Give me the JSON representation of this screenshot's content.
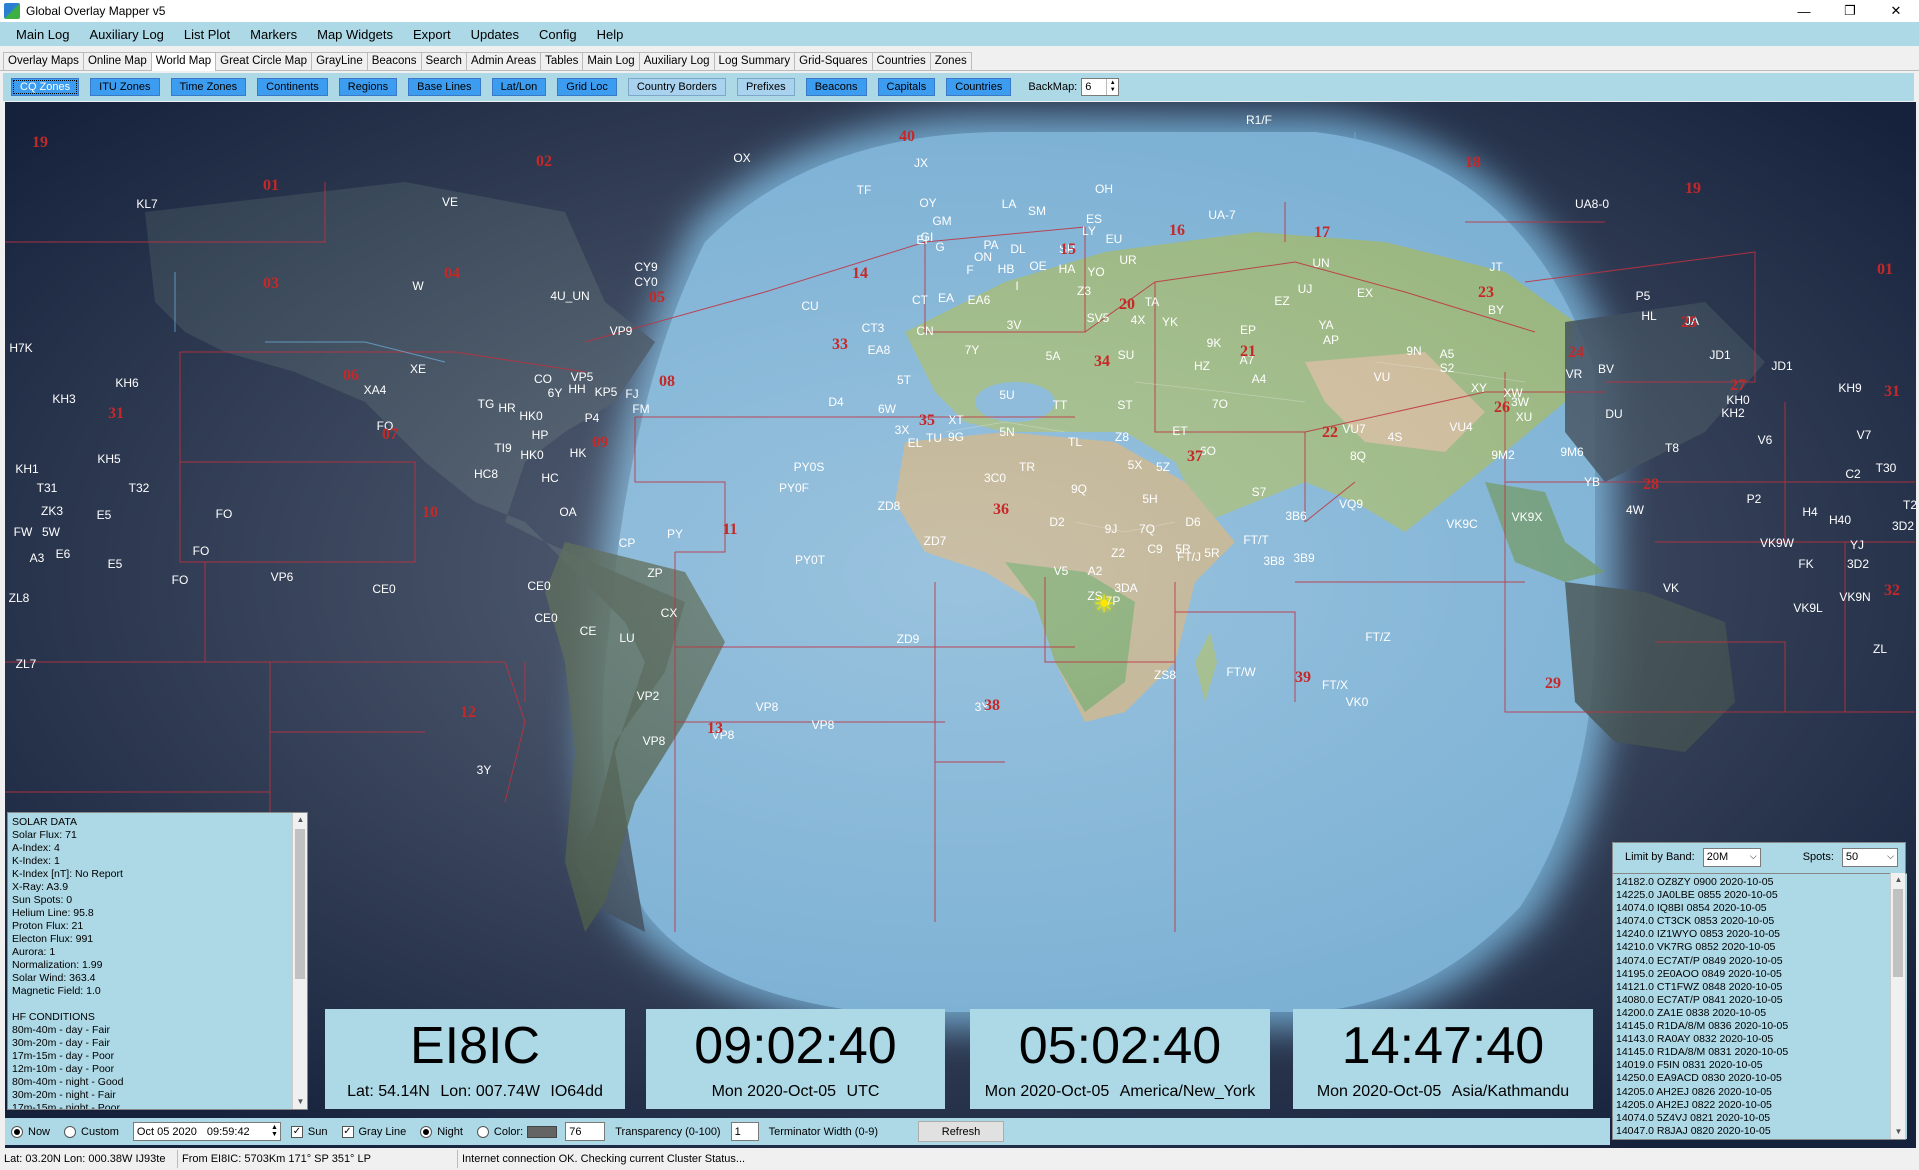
{
  "window": {
    "title": "Global Overlay Mapper v5",
    "minimize": "—",
    "maximize": "❐",
    "close": "✕"
  },
  "menu": [
    "Main Log",
    "Auxiliary Log",
    "List Plot",
    "Markers",
    "Map Widgets",
    "Export",
    "Updates",
    "Config",
    "Help"
  ],
  "tabs": [
    "Overlay Maps",
    "Online Map",
    "World Map",
    "Great Circle Map",
    "GrayLine",
    "Beacons",
    "Search",
    "Admin Areas",
    "Tables",
    "Main Log",
    "Auxiliary Log",
    "Log Summary",
    "Grid-Squares",
    "Countries",
    "Zones"
  ],
  "active_tab": "World Map",
  "toggles": [
    {
      "label": "CQ Zones",
      "state": "sel"
    },
    {
      "label": "ITU Zones",
      "state": "on"
    },
    {
      "label": "Time Zones",
      "state": "on"
    },
    {
      "label": "Continents",
      "state": "on"
    },
    {
      "label": "Regions",
      "state": "on"
    },
    {
      "label": "Base Lines",
      "state": "on"
    },
    {
      "label": "Lat/Lon",
      "state": "on"
    },
    {
      "label": "Grid Loc",
      "state": "on"
    },
    {
      "label": "Country Borders",
      "state": "off"
    },
    {
      "label": "Prefixes",
      "state": "off"
    },
    {
      "label": "Beacons",
      "state": "on"
    },
    {
      "label": "Capitals",
      "state": "on"
    },
    {
      "label": "Countries",
      "state": "on"
    }
  ],
  "backmap": {
    "label": "BackMap:",
    "value": "6"
  },
  "map": {
    "prefixes": [
      [
        "KL7",
        142,
        204
      ],
      [
        "VE",
        445,
        202
      ],
      [
        "W",
        413,
        286
      ],
      [
        "CY9",
        641,
        267
      ],
      [
        "CY0",
        641,
        282
      ],
      [
        "4U_UN",
        565,
        296
      ],
      [
        "VP9",
        616,
        331
      ],
      [
        "H7K",
        16,
        348
      ],
      [
        "KH6",
        122,
        383
      ],
      [
        "KH3",
        59,
        399
      ],
      [
        "XE",
        413,
        369
      ],
      [
        "XA4",
        370,
        390
      ],
      [
        "CO",
        538,
        379
      ],
      [
        "6Y",
        550,
        393
      ],
      [
        "VP5",
        577,
        377
      ],
      [
        "HH",
        572,
        389
      ],
      [
        "KP5",
        601,
        392
      ],
      [
        "FJ",
        627,
        394
      ],
      [
        "FM",
        636,
        409
      ],
      [
        "TG",
        481,
        404
      ],
      [
        "HR",
        502,
        408
      ],
      [
        "HK0",
        526,
        416
      ],
      [
        "P4",
        587,
        418
      ],
      [
        "FO",
        380,
        426
      ],
      [
        "HP",
        535,
        435
      ],
      [
        "TI9",
        498,
        448
      ],
      [
        "HK0",
        527,
        455
      ],
      [
        "HK",
        573,
        453
      ],
      [
        "HC8",
        481,
        474
      ],
      [
        "HC",
        545,
        478
      ],
      [
        "OA",
        563,
        512
      ],
      [
        "KH1",
        22,
        469
      ],
      [
        "KH5",
        104,
        459
      ],
      [
        "T31",
        42,
        488
      ],
      [
        "T32",
        134,
        488
      ],
      [
        "ZK3",
        47,
        511
      ],
      [
        "E5",
        99,
        515
      ],
      [
        "FW",
        18,
        532
      ],
      [
        "5W",
        46,
        532
      ],
      [
        "FO",
        219,
        514
      ],
      [
        "FO",
        196,
        551
      ],
      [
        "A3",
        32,
        558
      ],
      [
        "E6",
        58,
        554
      ],
      [
        "E5",
        110,
        564
      ],
      [
        "FO",
        175,
        580
      ],
      [
        "VP6",
        277,
        577
      ],
      [
        "ZL8",
        14,
        598
      ],
      [
        "CE0",
        379,
        589
      ],
      [
        "CE0",
        534,
        586
      ],
      [
        "CE0",
        541,
        618
      ],
      [
        "CE",
        583,
        631
      ],
      [
        "CP",
        622,
        543
      ],
      [
        "PY",
        670,
        534
      ],
      [
        "ZP",
        650,
        573
      ],
      [
        "CX",
        664,
        613
      ],
      [
        "LU",
        622,
        638
      ],
      [
        "VP2",
        643,
        696
      ],
      [
        "VP8",
        762,
        707
      ],
      [
        "VP8",
        818,
        725
      ],
      [
        "VP8",
        649,
        741
      ],
      [
        "3Y",
        479,
        770
      ],
      [
        "VP8",
        718,
        735
      ],
      [
        "JX",
        916,
        163
      ],
      [
        "OY",
        923,
        203
      ],
      [
        "TF",
        859,
        190
      ],
      [
        "GM",
        937,
        221
      ],
      [
        "GI",
        922,
        237
      ],
      [
        "EI",
        917,
        240
      ],
      [
        "G",
        935,
        247
      ],
      [
        "LA",
        1004,
        204
      ],
      [
        "SM",
        1032,
        211
      ],
      [
        "OH",
        1099,
        189
      ],
      [
        "ES",
        1089,
        219
      ],
      [
        "LY",
        1084,
        231
      ],
      [
        "EU",
        1109,
        239
      ],
      [
        "UA-7",
        1217,
        215
      ],
      [
        "DL",
        1013,
        249
      ],
      [
        "SP",
        1062,
        249
      ],
      [
        "UR",
        1123,
        260
      ],
      [
        "PA",
        986,
        245
      ],
      [
        "ON",
        978,
        257
      ],
      [
        "F",
        965,
        270
      ],
      [
        "HB",
        1001,
        269
      ],
      [
        "OE",
        1033,
        266
      ],
      [
        "HA",
        1062,
        269
      ],
      [
        "YO",
        1091,
        272
      ],
      [
        "CT",
        915,
        300
      ],
      [
        "EA",
        941,
        298
      ],
      [
        "EA6",
        974,
        300
      ],
      [
        "I",
        1012,
        286
      ],
      [
        "Z3",
        1079,
        291
      ],
      [
        "SV5",
        1093,
        318
      ],
      [
        "TA",
        1147,
        302
      ],
      [
        "CU",
        805,
        306
      ],
      [
        "CT3",
        868,
        328
      ],
      [
        "EA8",
        874,
        350
      ],
      [
        "CN",
        920,
        331
      ],
      [
        "3V",
        1009,
        325
      ],
      [
        "5A",
        1048,
        356
      ],
      [
        "SU",
        1121,
        355
      ],
      [
        "4X",
        1133,
        320
      ],
      [
        "YK",
        1165,
        322
      ],
      [
        "9K",
        1209,
        343
      ],
      [
        "EP",
        1243,
        330
      ],
      [
        "YA",
        1321,
        325
      ],
      [
        "AP",
        1326,
        340
      ],
      [
        "EZ",
        1277,
        301
      ],
      [
        "UN",
        1316,
        263
      ],
      [
        "UJ",
        1300,
        289
      ],
      [
        "EX",
        1360,
        293
      ],
      [
        "JT",
        1491,
        267
      ],
      [
        "BY",
        1491,
        310
      ],
      [
        "7Y",
        967,
        350
      ],
      [
        "5T",
        899,
        380
      ],
      [
        "5U",
        1002,
        395
      ],
      [
        "ST",
        1120,
        405
      ],
      [
        "TT",
        1055,
        405
      ],
      [
        "HZ",
        1197,
        366
      ],
      [
        "A4",
        1254,
        379
      ],
      [
        "7O",
        1215,
        404
      ],
      [
        "A7",
        1242,
        360
      ],
      [
        "D4",
        831,
        402
      ],
      [
        "6W",
        882,
        409
      ],
      [
        "3X",
        897,
        430
      ],
      [
        "XT",
        951,
        420
      ],
      [
        "5N",
        1002,
        432
      ],
      [
        "TU",
        929,
        438
      ],
      [
        "9G",
        951,
        437
      ],
      [
        "EL",
        910,
        443
      ],
      [
        "ET",
        1175,
        431
      ],
      [
        "TL",
        1070,
        442
      ],
      [
        "Z8",
        1117,
        437
      ],
      [
        "5R",
        1178,
        549
      ],
      [
        "3C0",
        990,
        478
      ],
      [
        "9Q",
        1074,
        489
      ],
      [
        "5H",
        1145,
        499
      ],
      [
        "5Z",
        1158,
        467
      ],
      [
        "5X",
        1130,
        465
      ],
      [
        "6O",
        1203,
        451
      ],
      [
        "TR",
        1022,
        467
      ],
      [
        "D2",
        1052,
        522
      ],
      [
        "9J",
        1106,
        529
      ],
      [
        "7Q",
        1142,
        529
      ],
      [
        "Z2",
        1113,
        553
      ],
      [
        "C9",
        1150,
        549
      ],
      [
        "V5",
        1056,
        571
      ],
      [
        "A2",
        1090,
        571
      ],
      [
        "ZS",
        1090,
        596
      ],
      [
        "3DA",
        1121,
        588
      ],
      [
        "7P",
        1108,
        601
      ],
      [
        "FT/J",
        1184,
        557
      ],
      [
        "5R",
        1207,
        553
      ],
      [
        "D6",
        1188,
        522
      ],
      [
        "S7",
        1254,
        492
      ],
      [
        "3B6",
        1291,
        516
      ],
      [
        "3B8",
        1269,
        561
      ],
      [
        "3B9",
        1299,
        558
      ],
      [
        "FT/T",
        1251,
        540
      ],
      [
        "VQ9",
        1346,
        504
      ],
      [
        "ZS8",
        1160,
        675
      ],
      [
        "FT/W",
        1236,
        672
      ],
      [
        "FT/X",
        1330,
        685
      ],
      [
        "VK0",
        1352,
        702
      ],
      [
        "FT/Z",
        1373,
        637
      ],
      [
        "ZD8",
        884,
        506
      ],
      [
        "ZD7",
        930,
        541
      ],
      [
        "ZD9",
        903,
        639
      ],
      [
        "PY0S",
        804,
        467
      ],
      [
        "PY0F",
        789,
        488
      ],
      [
        "PY0T",
        805,
        560
      ],
      [
        "3Y",
        977,
        707
      ],
      [
        "VU7",
        1349,
        429
      ],
      [
        "8Q",
        1353,
        456
      ],
      [
        "4S",
        1390,
        437
      ],
      [
        "VU4",
        1456,
        427
      ],
      [
        "XY",
        1474,
        388
      ],
      [
        "VU",
        1377,
        377
      ],
      [
        "S2",
        1442,
        368
      ],
      [
        "A5",
        1442,
        354
      ],
      [
        "9N",
        1409,
        351
      ],
      [
        "XW",
        1508,
        393
      ],
      [
        "XU",
        1519,
        417
      ],
      [
        "3W",
        1515,
        402
      ],
      [
        "9M2",
        1498,
        455
      ],
      [
        "9M6",
        1567,
        452
      ],
      [
        "BV",
        1601,
        369
      ],
      [
        "VR",
        1569,
        374
      ],
      [
        "HL",
        1644,
        316
      ],
      [
        "P5",
        1638,
        296
      ],
      [
        "JA",
        1687,
        321
      ],
      [
        "UA8-0",
        1587,
        204
      ],
      [
        "DU",
        1609,
        414
      ],
      [
        "YB",
        1587,
        482
      ],
      [
        "4W",
        1630,
        510
      ],
      [
        "VK9C",
        1457,
        524
      ],
      [
        "VK9X",
        1522,
        517
      ],
      [
        "H4",
        1805,
        512
      ],
      [
        "P2",
        1749,
        499
      ],
      [
        "VK9W",
        1772,
        543
      ],
      [
        "FK",
        1801,
        564
      ],
      [
        "YJ",
        1852,
        545
      ],
      [
        "3D2",
        1853,
        564
      ],
      [
        "VK",
        1666,
        588
      ],
      [
        "VK9L",
        1803,
        608
      ],
      [
        "VK9N",
        1850,
        597
      ],
      [
        "ZL",
        1875,
        649
      ],
      [
        "JD1",
        1715,
        355
      ],
      [
        "JD1",
        1777,
        366
      ],
      [
        "KH0",
        1733,
        400
      ],
      [
        "KH2",
        1728,
        413
      ],
      [
        "KH9",
        1845,
        388
      ],
      [
        "V6",
        1760,
        440
      ],
      [
        "V7",
        1859,
        435
      ],
      [
        "T8",
        1667,
        448
      ],
      [
        "C2",
        1848,
        474
      ],
      [
        "T30",
        1881,
        468
      ],
      [
        "T2",
        1905,
        505
      ],
      [
        "H40",
        1835,
        520
      ],
      [
        "3D2",
        1898,
        526
      ],
      [
        "ZL7",
        21,
        664
      ],
      [
        "R1/F",
        1254,
        120
      ],
      [
        "OX",
        737,
        158
      ]
    ],
    "cq_zones": [
      [
        "19",
        35,
        143
      ],
      [
        "01",
        266,
        186
      ],
      [
        "02",
        539,
        162
      ],
      [
        "40",
        902,
        137
      ],
      [
        "18",
        1468,
        163
      ],
      [
        "19",
        1688,
        189
      ],
      [
        "16",
        1172,
        231
      ],
      [
        "17",
        1317,
        233
      ],
      [
        "01",
        1880,
        270
      ],
      [
        "03",
        266,
        284
      ],
      [
        "04",
        447,
        274
      ],
      [
        "05",
        652,
        298
      ],
      [
        "14",
        855,
        274
      ],
      [
        "15",
        1063,
        250
      ],
      [
        "23",
        1481,
        293
      ],
      [
        "06",
        346,
        376
      ],
      [
        "08",
        662,
        382
      ],
      [
        "33",
        835,
        345
      ],
      [
        "20",
        1122,
        305
      ],
      [
        "34",
        1097,
        362
      ],
      [
        "21",
        1243,
        352
      ],
      [
        "24",
        1571,
        353
      ],
      [
        "25",
        1684,
        323
      ],
      [
        "27",
        1733,
        386
      ],
      [
        "31",
        111,
        414
      ],
      [
        "07",
        385,
        435
      ],
      [
        "09",
        595,
        443
      ],
      [
        "35",
        922,
        421
      ],
      [
        "26",
        1497,
        408
      ],
      [
        "31",
        1887,
        392
      ],
      [
        "22",
        1325,
        433
      ],
      [
        "37",
        1190,
        457
      ],
      [
        "28",
        1646,
        485
      ],
      [
        "10",
        425,
        513
      ],
      [
        "11",
        725,
        530
      ],
      [
        "36",
        996,
        510
      ],
      [
        "32",
        1887,
        591
      ],
      [
        "39",
        1298,
        678
      ],
      [
        "29",
        1548,
        684
      ],
      [
        "38",
        987,
        706
      ],
      [
        "13",
        710,
        729
      ],
      [
        "12",
        463,
        713
      ]
    ],
    "sun_glyph": "☀"
  },
  "solar_data": {
    "lines": [
      "SOLAR DATA",
      "Solar Flux: 71",
      "A-Index:  4",
      "K-Index:  1",
      "K-Index [nT]: No Report",
      "X-Ray: A3.9",
      "Sun Spots: 0",
      "Helium Line:  95.8",
      "Proton Flux: 21",
      "Electon Flux: 991",
      "Aurora:  1",
      "Normalization: 1.99",
      "Solar Wind: 363.4",
      "Magnetic Field:   1.0",
      "",
      "HF CONDITIONS",
      "80m-40m - day - Fair",
      "30m-20m - day - Fair",
      "17m-15m - day - Poor",
      "12m-10m - day - Poor",
      "80m-40m - night - Good",
      "30m-20m - night - Fair",
      "17m-15m - night - Poor"
    ]
  },
  "clocks": [
    {
      "big": "EI8IC",
      "small": [
        "Lat: 54.14N",
        "Lon: 007.74W",
        "IO64dd"
      ]
    },
    {
      "big": "09:02:40",
      "small": [
        "Mon 2020-Oct-05",
        "UTC"
      ]
    },
    {
      "big": "05:02:40",
      "small": [
        "Mon 2020-Oct-05",
        "America/New_York"
      ]
    },
    {
      "big": "14:47:40",
      "small": [
        "Mon 2020-Oct-05",
        "Asia/Kathmandu"
      ]
    }
  ],
  "spots": {
    "limit_label": "Limit by Band:",
    "band": "20M",
    "spots_label": "Spots:",
    "count": "50",
    "items": [
      "14182.0 OZ8ZY 0900 2020-10-05",
      "14225.0 JA0LBE 0855 2020-10-05",
      "14074.0 IQ8BI 0854 2020-10-05",
      "14074.0 CT3CK 0853 2020-10-05",
      "14240.0 IZ1WYO 0853 2020-10-05",
      "14210.0 VK7RG 0852 2020-10-05",
      "14074.0 EC7AT/P 0849 2020-10-05",
      "14195.0 2E0AOO 0849 2020-10-05",
      "14121.0 CT1FWZ 0848 2020-10-05",
      "14080.0 EC7AT/P 0841 2020-10-05",
      "14200.0 ZA1E 0838 2020-10-05",
      "14145.0 R1DA/8/M 0836 2020-10-05",
      "14143.0 RA0AY 0832 2020-10-05",
      "14145.0 R1DA/8/M 0831 2020-10-05",
      "14019.0 F5IN 0831 2020-10-05",
      "14250.0 EA9ACD 0830 2020-10-05",
      "14205.0 AH2EJ 0826 2020-10-05",
      "14205.0 AH2EJ 0822 2020-10-05",
      "14074.0 5Z4VJ 0821 2020-10-05",
      "14047.0 R8JAJ 0820 2020-10-05"
    ]
  },
  "controls": {
    "now": "Now",
    "custom": "Custom",
    "date": "Oct  05 2020",
    "time": "09:59:42",
    "sun": "Sun",
    "grayline": "Gray Line",
    "night": "Night",
    "color": "Color:",
    "transparency_value": "76",
    "transparency_label": "Transparency (0-100)",
    "terminator_value": "1",
    "terminator_label": "Terminator Width (0-9)",
    "refresh": "Refresh"
  },
  "status": {
    "cursor": "Lat: 03.20N  Lon: 000.38W  IJ93te",
    "bearing": "From EI8IC: 5703Km  171° SP  351° LP",
    "message": "Internet connection OK. Checking current Cluster Status..."
  }
}
